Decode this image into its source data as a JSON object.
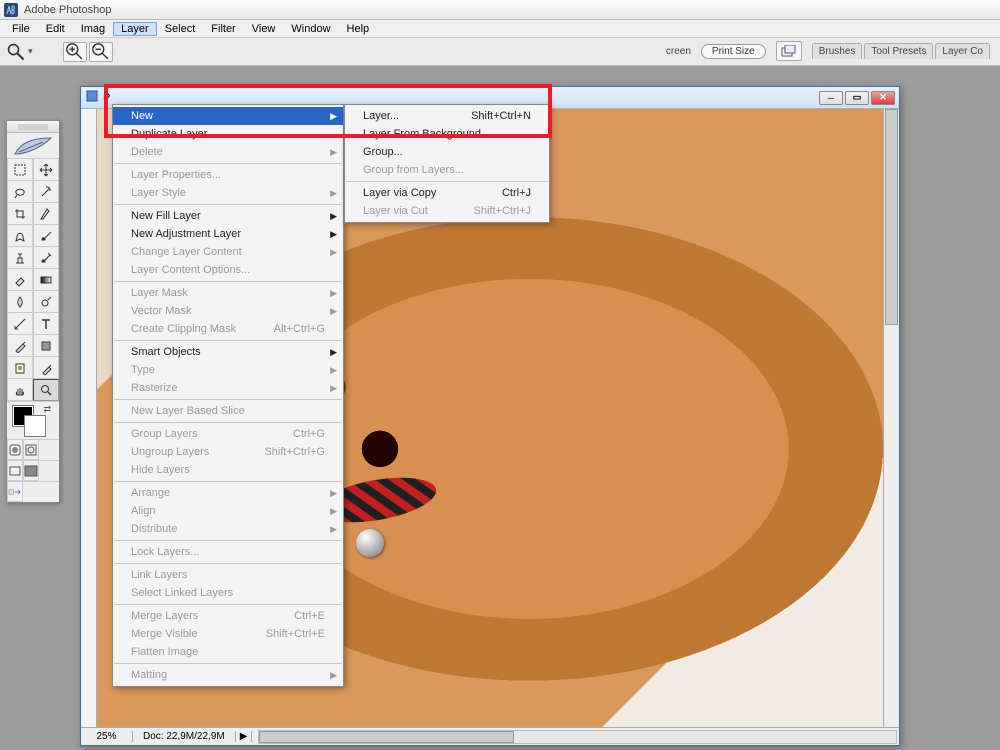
{
  "app": {
    "title": "Adobe Photoshop"
  },
  "menubar": [
    "File",
    "Edit",
    "Imag",
    "Layer",
    "Select",
    "Filter",
    "View",
    "Window",
    "Help"
  ],
  "menubar_highlight_index": 3,
  "optionsbar": {
    "screen_label": "creen",
    "print_size": "Print Size",
    "tabs": [
      "Brushes",
      "Tool Presets",
      "Layer Co"
    ]
  },
  "tools": [
    "marquee",
    "move",
    "lasso",
    "magic-wand",
    "crop",
    "slice",
    "healing",
    "brush",
    "clone",
    "history-brush",
    "eraser",
    "gradient",
    "blur",
    "dodge",
    "path",
    "type",
    "pen",
    "shape",
    "notes",
    "eyedropper",
    "hand",
    "zoom"
  ],
  "docwin": {
    "title": "P"
  },
  "status": {
    "zoom": "25%",
    "doc": "Doc: 22,9M/22,9M"
  },
  "layer_menu": [
    {
      "label": "New",
      "type": "sub",
      "hl": true
    },
    {
      "label": "Duplicate Layer...",
      "type": "item"
    },
    {
      "label": "Delete",
      "type": "sub",
      "disabled": true
    },
    {
      "type": "sep"
    },
    {
      "label": "Layer Properties...",
      "type": "item",
      "disabled": true
    },
    {
      "label": "Layer Style",
      "type": "sub",
      "disabled": true
    },
    {
      "type": "sep"
    },
    {
      "label": "New Fill Layer",
      "type": "sub"
    },
    {
      "label": "New Adjustment Layer",
      "type": "sub"
    },
    {
      "label": "Change Layer Content",
      "type": "sub",
      "disabled": true
    },
    {
      "label": "Layer Content Options...",
      "type": "item",
      "disabled": true
    },
    {
      "type": "sep"
    },
    {
      "label": "Layer Mask",
      "type": "sub",
      "disabled": true
    },
    {
      "label": "Vector Mask",
      "type": "sub",
      "disabled": true
    },
    {
      "label": "Create Clipping Mask",
      "type": "item",
      "shortcut": "Alt+Ctrl+G",
      "disabled": true
    },
    {
      "type": "sep"
    },
    {
      "label": "Smart Objects",
      "type": "sub"
    },
    {
      "label": "Type",
      "type": "sub",
      "disabled": true
    },
    {
      "label": "Rasterize",
      "type": "sub",
      "disabled": true
    },
    {
      "type": "sep"
    },
    {
      "label": "New Layer Based Slice",
      "type": "item",
      "disabled": true
    },
    {
      "type": "sep"
    },
    {
      "label": "Group Layers",
      "type": "item",
      "shortcut": "Ctrl+G",
      "disabled": true
    },
    {
      "label": "Ungroup Layers",
      "type": "item",
      "shortcut": "Shift+Ctrl+G",
      "disabled": true
    },
    {
      "label": "Hide Layers",
      "type": "item",
      "disabled": true
    },
    {
      "type": "sep"
    },
    {
      "label": "Arrange",
      "type": "sub",
      "disabled": true
    },
    {
      "label": "Align",
      "type": "sub",
      "disabled": true
    },
    {
      "label": "Distribute",
      "type": "sub",
      "disabled": true
    },
    {
      "type": "sep"
    },
    {
      "label": "Lock Layers...",
      "type": "item",
      "disabled": true
    },
    {
      "type": "sep"
    },
    {
      "label": "Link Layers",
      "type": "item",
      "disabled": true
    },
    {
      "label": "Select Linked Layers",
      "type": "item",
      "disabled": true
    },
    {
      "type": "sep"
    },
    {
      "label": "Merge Layers",
      "type": "item",
      "shortcut": "Ctrl+E",
      "disabled": true
    },
    {
      "label": "Merge Visible",
      "type": "item",
      "shortcut": "Shift+Ctrl+E",
      "disabled": true
    },
    {
      "label": "Flatten Image",
      "type": "item",
      "disabled": true
    },
    {
      "type": "sep"
    },
    {
      "label": "Matting",
      "type": "sub",
      "disabled": true
    }
  ],
  "new_submenu": [
    {
      "label": "Layer...",
      "shortcut": "Shift+Ctrl+N"
    },
    {
      "label": "Layer From Background..."
    },
    {
      "label": "Group..."
    },
    {
      "label": "Group from Layers...",
      "disabled": true
    },
    {
      "type": "sep"
    },
    {
      "label": "Layer via Copy",
      "shortcut": "Ctrl+J"
    },
    {
      "label": "Layer via Cut",
      "shortcut": "Shift+Ctrl+J",
      "disabled": true
    }
  ]
}
